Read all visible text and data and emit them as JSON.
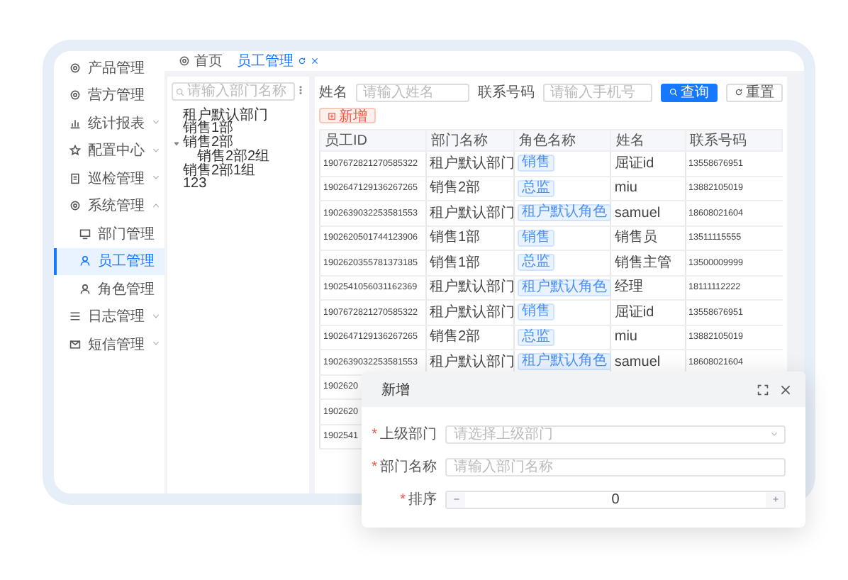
{
  "sidebar": {
    "items": [
      {
        "label": "产品管理",
        "selected": false
      },
      {
        "label": "营方管理",
        "selected": false
      },
      {
        "label": "统计报表",
        "selected": false,
        "expanded": false
      },
      {
        "label": "配置中心",
        "selected": false,
        "expanded": false
      },
      {
        "label": "巡检管理",
        "selected": false,
        "expanded": false
      },
      {
        "label": "系统管理",
        "selected": false,
        "expanded": true,
        "children": [
          {
            "label": "部门管理",
            "selected": false
          },
          {
            "label": "员工管理",
            "selected": true
          },
          {
            "label": "角色管理",
            "selected": false
          }
        ]
      },
      {
        "label": "日志管理",
        "selected": false,
        "expanded": false
      },
      {
        "label": "短信管理",
        "selected": false,
        "expanded": false
      }
    ]
  },
  "tabs": [
    {
      "label": "首页",
      "selected": false
    },
    {
      "label": "员工管理",
      "selected": true
    }
  ],
  "dept_tree": {
    "search": {
      "placeholder": "请输入部门名称"
    },
    "nodes": [
      {
        "label": "租户默认部门"
      },
      {
        "label": "销售1部"
      },
      {
        "label": "销售2部",
        "expanded": true,
        "children": [
          {
            "label": "销售2部2组"
          }
        ]
      },
      {
        "label": "销售2部1组"
      },
      {
        "label": "123"
      }
    ]
  },
  "filters": [
    {
      "label": "姓名",
      "placeholder": "请输入姓名"
    },
    {
      "label": "联系号码",
      "placeholder": "请输入手机号"
    }
  ],
  "buttons": [
    {
      "label": "查询",
      "kind": "primary"
    },
    {
      "label": "重置",
      "kind": "default"
    }
  ],
  "add_button": {
    "label": "新增"
  },
  "table": {
    "columns": [
      "员工ID",
      "部门名称",
      "角色名称",
      "姓名",
      "联系号码"
    ],
    "rows": [
      [
        "1907672821270585322",
        "租户默认部门",
        "销售",
        "屈证id",
        "13558676951"
      ],
      [
        "1902647129136267265",
        "销售2部",
        "总监",
        "miu",
        "13882105019"
      ],
      [
        "1902639032253581553",
        "租户默认部门",
        "租户默认角色",
        "samuel",
        "18608021604"
      ],
      [
        "1902620501744123906",
        "销售1部",
        "销售",
        "销售员",
        "13511115555"
      ],
      [
        "1902620355781373185",
        "销售1部",
        "总监",
        "销售主管",
        "13500009999"
      ],
      [
        "1902541056031162369",
        "租户默认部门",
        "租户默认角色",
        "经理",
        "18111112222"
      ],
      [
        "1907672821270585322",
        "租户默认部门",
        "销售",
        "屈证id",
        "13558676951"
      ],
      [
        "1902647129136267265",
        "销售2部",
        "总监",
        "miu",
        "13882105019"
      ],
      [
        "1902639032253581553",
        "租户默认部门",
        "租户默认角色",
        "samuel",
        "18608021604"
      ],
      [
        "1902620"
      ],
      [
        "1902620"
      ],
      [
        "1902541"
      ]
    ]
  },
  "dialog": {
    "title": "新增",
    "fields": [
      {
        "label": "上级部门",
        "required_mark": "*",
        "kind": "select",
        "placeholder": "请选择上级部门"
      },
      {
        "label": "部门名称",
        "required_mark": "*",
        "kind": "input",
        "placeholder": "请输入部门名称"
      },
      {
        "label": "排序",
        "required_mark": "*",
        "kind": "number",
        "value": "0"
      }
    ]
  }
}
